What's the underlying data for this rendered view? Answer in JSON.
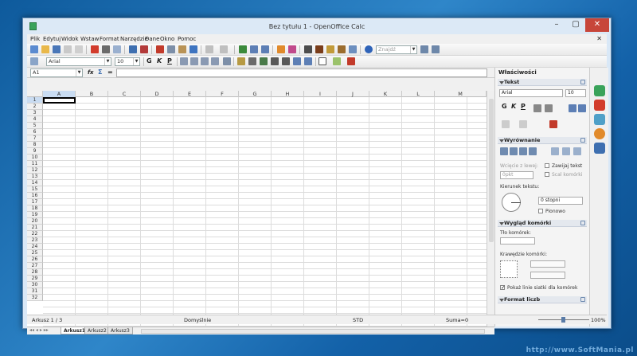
{
  "window": {
    "title": "Bez tytułu 1 - OpenOffice Calc",
    "min": "–",
    "max": "▢",
    "close": "✕"
  },
  "menu": [
    "Plik",
    "Edytuj",
    "Widok",
    "Wstaw",
    "Format",
    "Narzędzie",
    "Dane",
    "Okno",
    "Pomoc"
  ],
  "menu_close": "✕",
  "toolbar": {
    "find_placeholder": "Znajdź"
  },
  "format": {
    "font": "Arial",
    "size": "10",
    "bold": "G",
    "italic": "K",
    "underline": "P"
  },
  "formula": {
    "cell_ref": "A1",
    "fx": "fx",
    "sum": "Σ",
    "eq": "="
  },
  "columns": [
    "A",
    "B",
    "C",
    "D",
    "E",
    "F",
    "G",
    "H",
    "I",
    "J",
    "K",
    "L",
    "M"
  ],
  "rows": [
    "1",
    "2",
    "3",
    "4",
    "5",
    "6",
    "7",
    "8",
    "9",
    "10",
    "11",
    "12",
    "13",
    "14",
    "15",
    "16",
    "17",
    "18",
    "19",
    "20",
    "21",
    "22",
    "23",
    "24",
    "25",
    "26",
    "27",
    "28",
    "29",
    "30",
    "31",
    "32"
  ],
  "sheets": [
    "Arkusz1",
    "Arkusz2",
    "Arkusz3"
  ],
  "status": {
    "sheet": "Arkusz 1 / 3",
    "style": "Domyślnie",
    "mode": "STD",
    "sum": "Suma=0",
    "zoom": "100%"
  },
  "sidebar": {
    "title": "Właściwości",
    "text_section": "Tekst",
    "font": "Arial",
    "size": "10",
    "bold": "G",
    "italic": "K",
    "underline": "P",
    "align_section": "Wyrównanie",
    "indent_label": "Wcięcie z lewej:",
    "indent_value": "0pkt",
    "wrap": "Zawijaj tekst",
    "merge": "Scal komórki",
    "direction_label": "Kierunek tekstu:",
    "angle": "0 stopni",
    "vertical": "Pionowo",
    "cell_section": "Wygląd komórki",
    "bg_label": "Tło komórek:",
    "borders_label": "Krawędzie komórki:",
    "gridlines": "Pokaż linie siatki dla komórek",
    "number_section": "Format liczb"
  },
  "watermark": "http://www.SoftMania.pl"
}
